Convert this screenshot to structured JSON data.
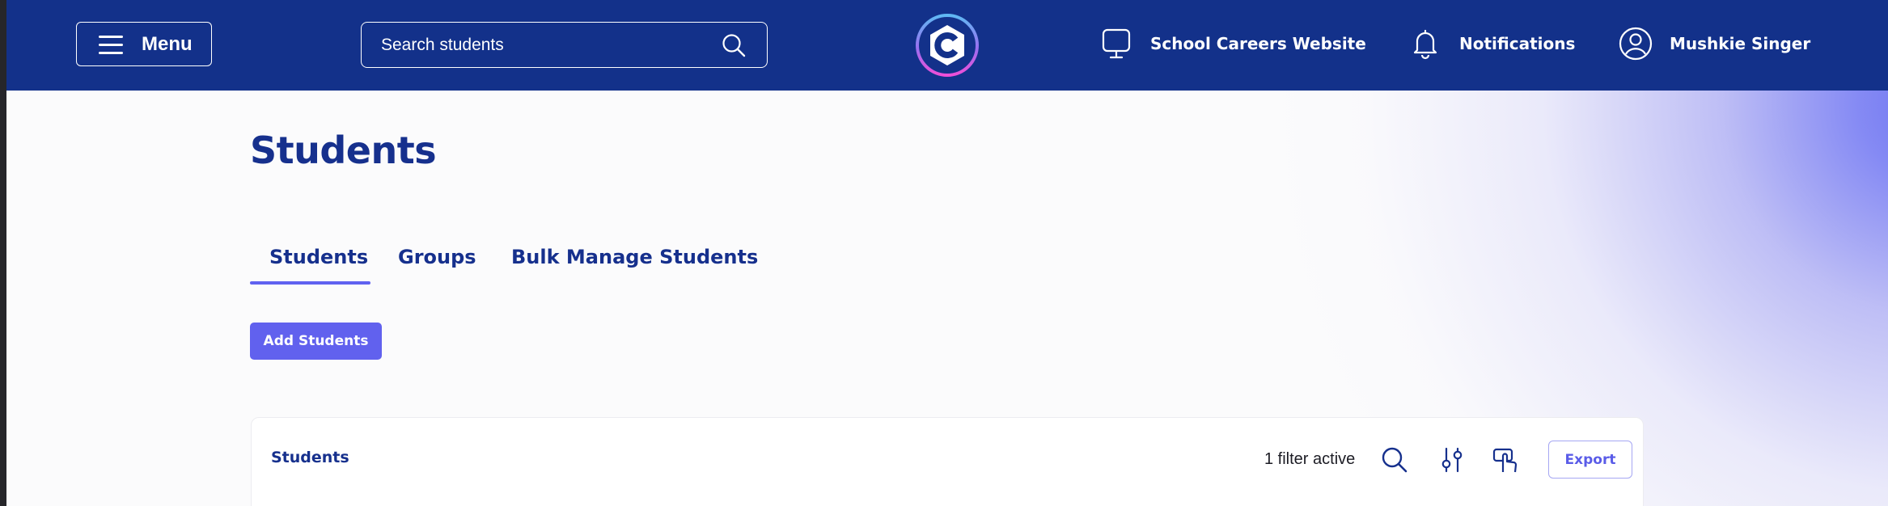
{
  "header": {
    "menu_label": "Menu",
    "search_placeholder": "Search students",
    "links": [
      {
        "label": "School Careers Website",
        "icon": "monitor-icon"
      },
      {
        "label": "Notifications",
        "icon": "bell-icon"
      },
      {
        "label": "Mushkie Singer",
        "icon": "user-avatar-icon"
      }
    ],
    "logo_letter": "C"
  },
  "main": {
    "page_title": "Students",
    "tabs": [
      {
        "label": "Students",
        "active": true
      },
      {
        "label": "Groups",
        "active": false
      },
      {
        "label": "Bulk Manage Students",
        "active": false
      }
    ],
    "add_button_label": "Add Students"
  },
  "card": {
    "title": "Students",
    "filter_status": "1 filter active",
    "tools": [
      "search-icon",
      "sliders-icon",
      "pointer-select-icon"
    ],
    "export_label": "Export"
  },
  "colors": {
    "header_bg": "#13318a",
    "accent": "#6161ee",
    "heading": "#16308d"
  }
}
